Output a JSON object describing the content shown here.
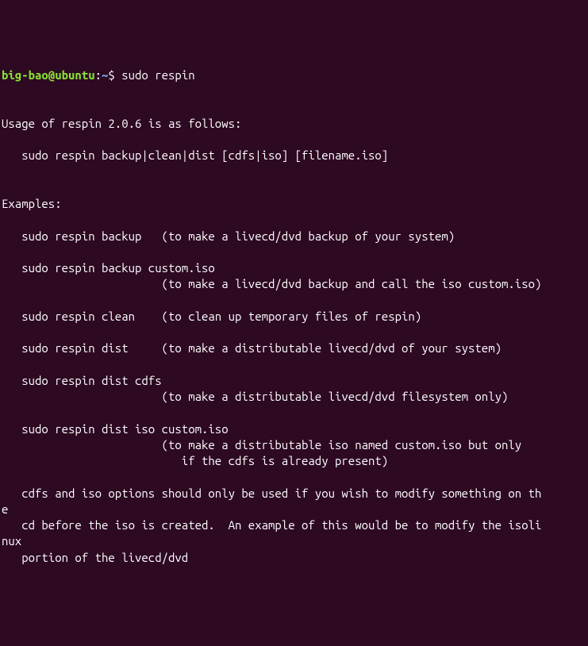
{
  "prompt": {
    "user_host": "big-bao@ubuntu",
    "separator": ":",
    "path": "~",
    "dollar": "$ ",
    "command": "sudo respin"
  },
  "output": {
    "l1": "Usage of respin 2.0.6 is as follows:",
    "l2": "   sudo respin backup|clean|dist [cdfs|iso] [filename.iso]",
    "l3": "Examples:",
    "l4": "   sudo respin backup   (to make a livecd/dvd backup of your system)",
    "l5": "   sudo respin backup custom.iso",
    "l6": "                        (to make a livecd/dvd backup and call the iso custom.iso)",
    "l7": "   sudo respin clean    (to clean up temporary files of respin)",
    "l8": "   sudo respin dist     (to make a distributable livecd/dvd of your system)",
    "l9": "   sudo respin dist cdfs",
    "l10": "                        (to make a distributable livecd/dvd filesystem only)",
    "l11": "   sudo respin dist iso custom.iso",
    "l12": "                        (to make a distributable iso named custom.iso but only",
    "l13": "                           if the cdfs is already present)",
    "l14": "   cdfs and iso options should only be used if you wish to modify something on th",
    "l14b": "e",
    "l15": "   cd before the iso is created.  An example of this would be to modify the isoli",
    "l15b": "nux",
    "l16": "   portion of the livecd/dvd"
  }
}
